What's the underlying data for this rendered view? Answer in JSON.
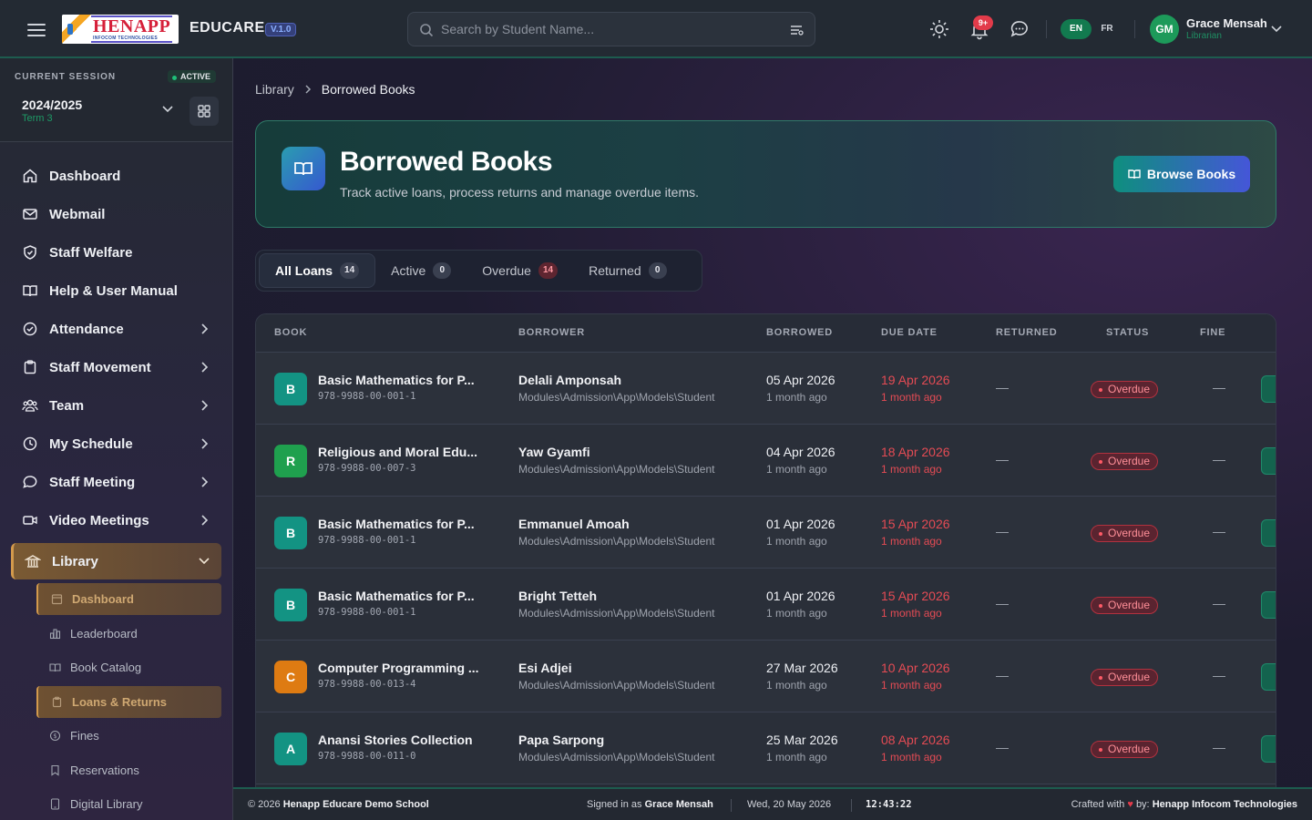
{
  "header": {
    "logo_text": "HENAPP",
    "logo_subtext": "INFOCOM TECHNOLOGIES",
    "brand": "EDUCARE",
    "version": "V.1.0",
    "search_placeholder": "Search by Student Name...",
    "notifications_count": "9+",
    "lang_en": "EN",
    "lang_fr": "FR",
    "user_initials": "GM",
    "user_name": "Grace Mensah",
    "user_role": "Librarian"
  },
  "session": {
    "label": "CURRENT SESSION",
    "status": "ACTIVE",
    "year": "2024/2025",
    "term": "Term 3"
  },
  "sidebar": {
    "items": [
      {
        "label": "Dashboard",
        "icon": "home-icon",
        "expandable": false
      },
      {
        "label": "Webmail",
        "icon": "mail-icon",
        "expandable": false
      },
      {
        "label": "Staff Welfare",
        "icon": "shield-icon",
        "expandable": false
      },
      {
        "label": "Help & User Manual",
        "icon": "book-icon",
        "expandable": false
      },
      {
        "label": "Attendance",
        "icon": "check-circle-icon",
        "expandable": true
      },
      {
        "label": "Staff Movement",
        "icon": "clipboard-icon",
        "expandable": true
      },
      {
        "label": "Team",
        "icon": "users-icon",
        "expandable": true
      },
      {
        "label": "My Schedule",
        "icon": "clock-icon",
        "expandable": true
      },
      {
        "label": "Staff Meeting",
        "icon": "chat-icon",
        "expandable": true
      },
      {
        "label": "Video Meetings",
        "icon": "video-icon",
        "expandable": true
      }
    ],
    "active_item": {
      "label": "Library",
      "icon": "library-icon"
    },
    "sub_items": [
      {
        "label": "Dashboard",
        "icon": "calendar-icon",
        "highlight": true
      },
      {
        "label": "Leaderboard",
        "icon": "bar-chart-icon",
        "highlight": false
      },
      {
        "label": "Book Catalog",
        "icon": "open-book-icon",
        "highlight": false
      },
      {
        "label": "Loans & Returns",
        "icon": "clipboard-icon",
        "highlight": true
      },
      {
        "label": "Fines",
        "icon": "coin-icon",
        "highlight": false
      },
      {
        "label": "Reservations",
        "icon": "bookmark-icon",
        "highlight": false
      },
      {
        "label": "Digital Library",
        "icon": "tablet-icon",
        "highlight": false
      }
    ]
  },
  "breadcrumb": {
    "parent": "Library",
    "current": "Borrowed Books"
  },
  "hero": {
    "title": "Borrowed Books",
    "subtitle": "Track active loans, process returns and manage overdue items.",
    "button_label": "Browse Books"
  },
  "tabs": [
    {
      "label": "All Loans",
      "count": "14",
      "active": true,
      "red": false
    },
    {
      "label": "Active",
      "count": "0",
      "active": false,
      "red": false
    },
    {
      "label": "Overdue",
      "count": "14",
      "active": false,
      "red": true
    },
    {
      "label": "Returned",
      "count": "0",
      "active": false,
      "red": false
    }
  ],
  "table": {
    "headers": [
      "BOOK",
      "BORROWER",
      "BORROWED",
      "DUE DATE",
      "RETURNED",
      "STATUS",
      "FINE"
    ],
    "rows": [
      {
        "badge": "B",
        "badge_color": "#139383",
        "title": "Basic Mathematics for P...",
        "isbn": "978-9988-00-001-1",
        "borrower": "Delali Amponsah",
        "borrower_type": "Modules\\Admission\\App\\Models\\Student",
        "borrowed": "05 Apr 2026",
        "borrowed_ago": "1 month ago",
        "due": "19 Apr 2026",
        "due_ago": "1 month ago",
        "returned": "—",
        "status": "Overdue",
        "fine": "—"
      },
      {
        "badge": "R",
        "badge_color": "#1fa04e",
        "title": "Religious and Moral Edu...",
        "isbn": "978-9988-00-007-3",
        "borrower": "Yaw Gyamfi",
        "borrower_type": "Modules\\Admission\\App\\Models\\Student",
        "borrowed": "04 Apr 2026",
        "borrowed_ago": "1 month ago",
        "due": "18 Apr 2026",
        "due_ago": "1 month ago",
        "returned": "—",
        "status": "Overdue",
        "fine": "—"
      },
      {
        "badge": "B",
        "badge_color": "#139383",
        "title": "Basic Mathematics for P...",
        "isbn": "978-9988-00-001-1",
        "borrower": "Emmanuel Amoah",
        "borrower_type": "Modules\\Admission\\App\\Models\\Student",
        "borrowed": "01 Apr 2026",
        "borrowed_ago": "1 month ago",
        "due": "15 Apr 2026",
        "due_ago": "1 month ago",
        "returned": "—",
        "status": "Overdue",
        "fine": "—"
      },
      {
        "badge": "B",
        "badge_color": "#139383",
        "title": "Basic Mathematics for P...",
        "isbn": "978-9988-00-001-1",
        "borrower": "Bright Tetteh",
        "borrower_type": "Modules\\Admission\\App\\Models\\Student",
        "borrowed": "01 Apr 2026",
        "borrowed_ago": "1 month ago",
        "due": "15 Apr 2026",
        "due_ago": "1 month ago",
        "returned": "—",
        "status": "Overdue",
        "fine": "—"
      },
      {
        "badge": "C",
        "badge_color": "#de7b12",
        "title": "Computer Programming ...",
        "isbn": "978-9988-00-013-4",
        "borrower": "Esi Adjei",
        "borrower_type": "Modules\\Admission\\App\\Models\\Student",
        "borrowed": "27 Mar 2026",
        "borrowed_ago": "1 month ago",
        "due": "10 Apr 2026",
        "due_ago": "1 month ago",
        "returned": "—",
        "status": "Overdue",
        "fine": "—"
      },
      {
        "badge": "A",
        "badge_color": "#139383",
        "title": "Anansi Stories Collection",
        "isbn": "978-9988-00-011-0",
        "borrower": "Papa Sarpong",
        "borrower_type": "Modules\\Admission\\App\\Models\\Student",
        "borrowed": "25 Mar 2026",
        "borrowed_ago": "1 month ago",
        "due": "08 Apr 2026",
        "due_ago": "1 month ago",
        "returned": "—",
        "status": "Overdue",
        "fine": "—"
      }
    ]
  },
  "footer": {
    "copyright_prefix": "© 2026",
    "school": "Henapp Educare Demo School",
    "signed_in_prefix": "Signed in as",
    "signed_in_user": "Grace Mensah",
    "date": "Wed, 20 May 2026",
    "time": "12:43:22",
    "crafted_prefix": "Crafted with",
    "crafted_by": "by:",
    "company": "Henapp Infocom Technologies"
  },
  "colors": {
    "accent_green": "#127a4f",
    "overdue_red": "#e44b54",
    "library_active": "#d39a4c"
  }
}
